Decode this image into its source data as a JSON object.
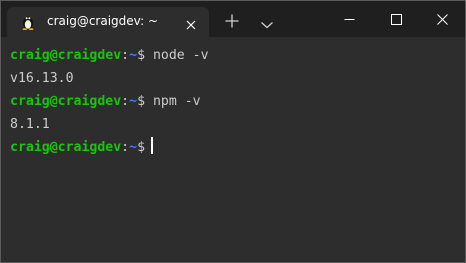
{
  "tab": {
    "icon": "linux-penguin-icon",
    "title": "craig@craigdev: ~"
  },
  "titlebar": {
    "new_tab_icon": "plus-icon",
    "dropdown_icon": "chevron-down-icon",
    "minimize_icon": "minimize-icon",
    "maximize_icon": "maximize-icon",
    "close_icon": "close-icon"
  },
  "terminal": {
    "lines": [
      {
        "user": "craig@craigdev",
        "colon": ":",
        "path": "~",
        "symbol": "$",
        "command": " node -v"
      },
      {
        "output": "v16.13.0"
      },
      {
        "user": "craig@craigdev",
        "colon": ":",
        "path": "~",
        "symbol": "$",
        "command": " npm -v"
      },
      {
        "output": "8.1.1"
      },
      {
        "user": "craig@craigdev",
        "colon": ":",
        "path": "~",
        "symbol": "$",
        "command": ""
      }
    ]
  },
  "colors": {
    "titlebar_bg": "#1f1f1f",
    "terminal_bg": "#2d2d2d",
    "user_green": "#16c60c",
    "path_blue": "#3b78ff",
    "text": "#cccccc"
  }
}
